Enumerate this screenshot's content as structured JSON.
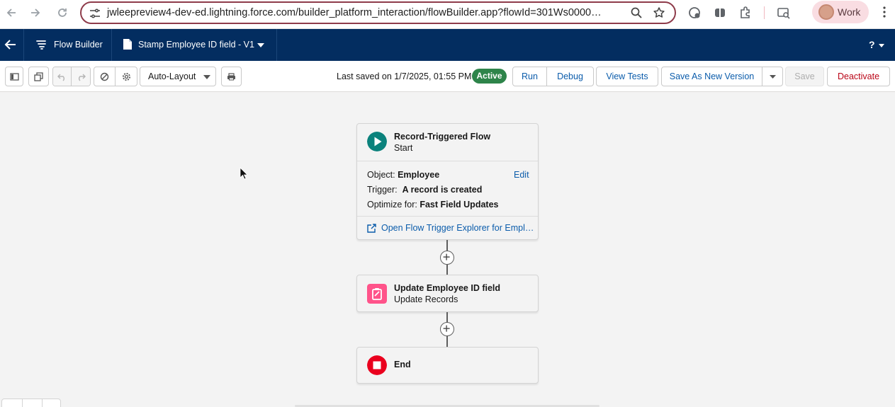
{
  "browser": {
    "url": "jwleepreview4-dev-ed.lightning.force.com/builder_platform_interaction/flowBuilder.app?flowId=301Ws0000…",
    "profile_name": "Work"
  },
  "header": {
    "app_label": "Flow Builder",
    "flow_name": "Stamp Employee ID field - V1",
    "help_label": "?"
  },
  "toolbar": {
    "layout_mode": "Auto-Layout",
    "last_saved": "Last saved on 1/7/2025, 01:55 PM",
    "status_badge": "Active",
    "run_label": "Run",
    "debug_label": "Debug",
    "view_tests_label": "View Tests",
    "save_new_version_label": "Save As New Version",
    "save_label": "Save",
    "deactivate_label": "Deactivate"
  },
  "flow": {
    "start": {
      "title": "Record-Triggered Flow",
      "subtitle": "Start",
      "object_label": "Object:",
      "object_value": "Employee",
      "edit_label": "Edit",
      "trigger_label": "Trigger:",
      "trigger_value": "A record is created",
      "optimize_label": "Optimize for:",
      "optimize_value": "Fast Field Updates",
      "explorer_link": "Open Flow Trigger Explorer for Empl…"
    },
    "update": {
      "title": "Update Employee ID field",
      "subtitle": "Update Records"
    },
    "end": {
      "title": "End"
    }
  },
  "colors": {
    "app_header": "#032d60",
    "active_badge": "#2e844a",
    "start_icon": "#0b827c",
    "update_icon": "#ff538a",
    "end_icon": "#ea001e",
    "link": "#0b5cab",
    "deactivate": "#ba0517"
  }
}
